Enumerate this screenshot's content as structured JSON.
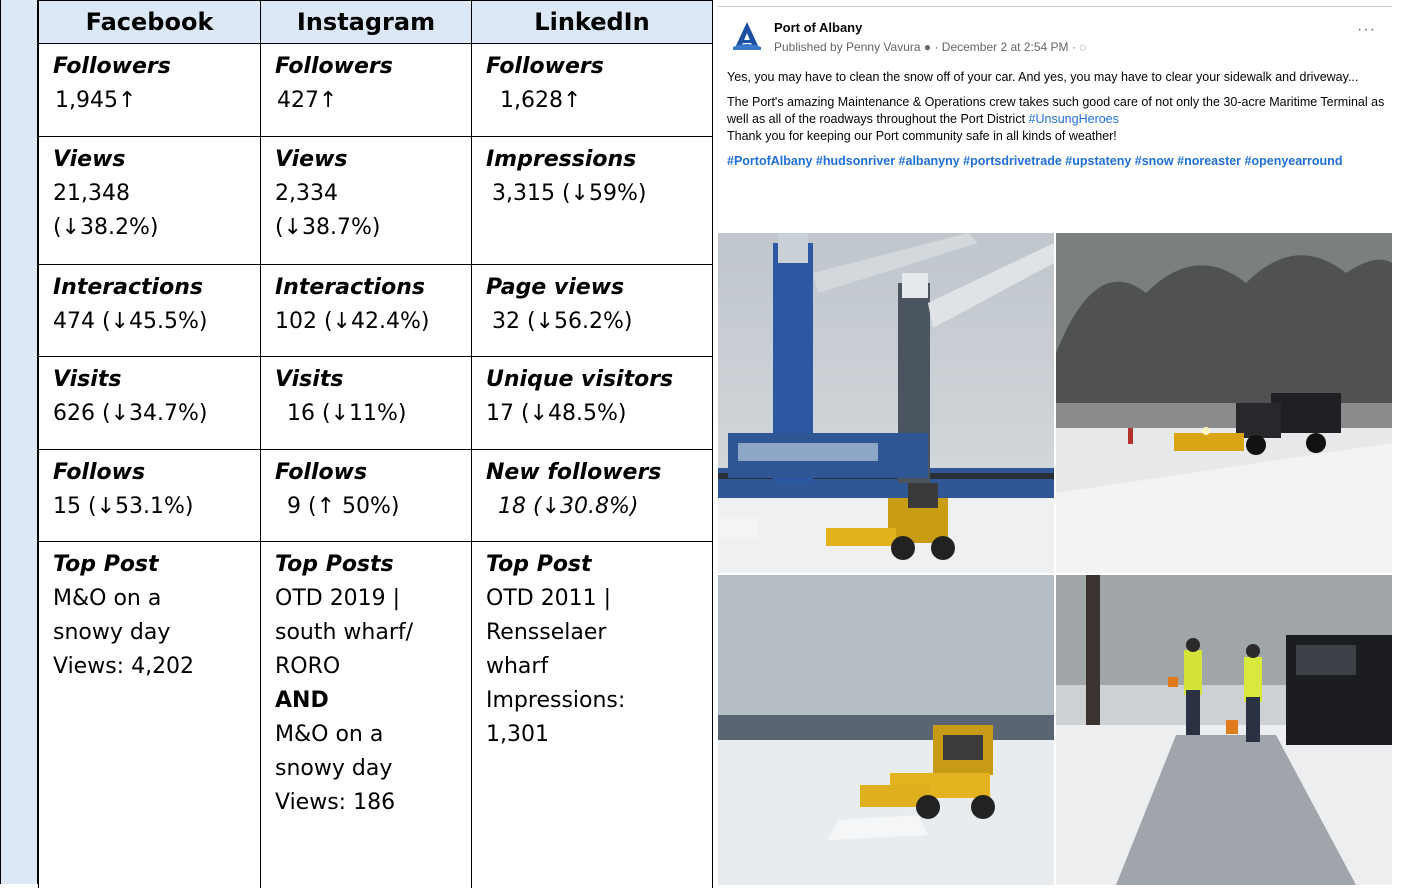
{
  "headers": [
    "Facebook",
    "Instagram",
    "LinkedIn"
  ],
  "rows": [
    [
      {
        "label": "Followers",
        "value": "1,945↑"
      },
      {
        "label": "Followers",
        "value": "427↑"
      },
      {
        "label": "Followers",
        "value": "1,628↑"
      }
    ],
    [
      {
        "label": "Views",
        "value": "21,348\n(↓38.2%)"
      },
      {
        "label": "Views",
        "value": "2,334\n(↓38.7%)"
      },
      {
        "label": "Impressions",
        "value": "3,315 (↓59%)"
      }
    ],
    [
      {
        "label": "Interactions",
        "value": "474 (↓45.5%)"
      },
      {
        "label": "Interactions",
        "value": "102 (↓42.4%)"
      },
      {
        "label": "Page views",
        "value": "32 (↓56.2%)"
      }
    ],
    [
      {
        "label": "Visits",
        "value": "626 (↓34.7%)"
      },
      {
        "label": "Visits",
        "value": "16 (↓11%)"
      },
      {
        "label": "Unique visitors",
        "value": "17 (↓48.5%)"
      }
    ],
    [
      {
        "label": "Follows",
        "value": "15 (↓53.1%)"
      },
      {
        "label": "Follows",
        "value": "9 (↑ 50%)"
      },
      {
        "label": "New followers",
        "value": "18 (↓30.8%)"
      }
    ]
  ],
  "top_posts": {
    "facebook": {
      "label": "Top Post",
      "lines": [
        "M&O on a",
        "snowy day",
        "Views: 4,202"
      ]
    },
    "instagram": {
      "label": "Top Posts",
      "lines_a": [
        "OTD 2019 |",
        "south wharf/",
        "RORO"
      ],
      "and": "AND",
      "lines_b": [
        "M&O on a",
        "snowy day",
        "Views: 186"
      ]
    },
    "linkedin": {
      "label": "Top Post",
      "lines": [
        "OTD 2011 |",
        "Rensselaer",
        "wharf",
        "Impressions:",
        "1,301"
      ]
    }
  },
  "post": {
    "page_name": "Port of Albany",
    "logo_letter": "A",
    "meta": "Published by Penny Vavura ● · December 2 at 2:54 PM · ◌",
    "more": "···",
    "para1": "Yes, you may have to clean the snow off of your car. And yes, you may have to clear your sidewalk and driveway...",
    "para2": "The Port's amazing Maintenance & Operations crew takes such good care of not only the 30-acre Maritime Terminal as well as all of the roadways throughout the Port District",
    "para2_tag": "#UnsungHeroes",
    "para3": "Thank you for keeping our Port community safe in all kinds of weather!",
    "hashtags": "#PortofAlbany #hudsonriver #albanyny #portsdrivetrade #upstateny #snow #noreaster #openyearround",
    "photos": [
      {
        "name": "cranes-loader-photo"
      },
      {
        "name": "plow-truck-photo"
      },
      {
        "name": "loader-plow-photo"
      },
      {
        "name": "sidewalk-shoveling-photo"
      }
    ]
  },
  "colors": {
    "header_bg": "#dce8f6",
    "link": "#216fdb",
    "logo": "#1c4ea1"
  }
}
